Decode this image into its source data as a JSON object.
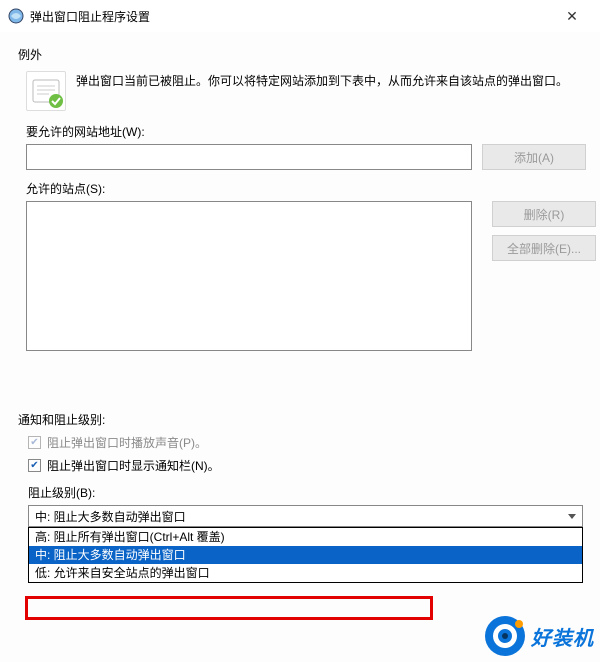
{
  "title": "弹出窗口阻止程序设置",
  "exceptions_header": "例外",
  "info_text": "弹出窗口当前已被阻止。你可以将特定网站添加到下表中，从而允许来自该站点的弹出窗口。",
  "address_label": "要允许的网站地址(W):",
  "add_btn": "添加(A)",
  "allowed_label": "允许的站点(S):",
  "remove_btn": "删除(R)",
  "remove_all_btn": "全部删除(E)...",
  "notif_header": "通知和阻止级别:",
  "cb_sound": "阻止弹出窗口时播放声音(P)。",
  "cb_bar": "阻止弹出窗口时显示通知栏(N)。",
  "level_label": "阻止级别(B):",
  "combo_selected": "中: 阻止大多数自动弹出窗口",
  "options": {
    "high": "高: 阻止所有弹出窗口(Ctrl+Alt 覆盖)",
    "medium": "中: 阻止大多数自动弹出窗口",
    "low": "低: 允许来自安全站点的弹出窗口"
  },
  "watermark": "好装机"
}
